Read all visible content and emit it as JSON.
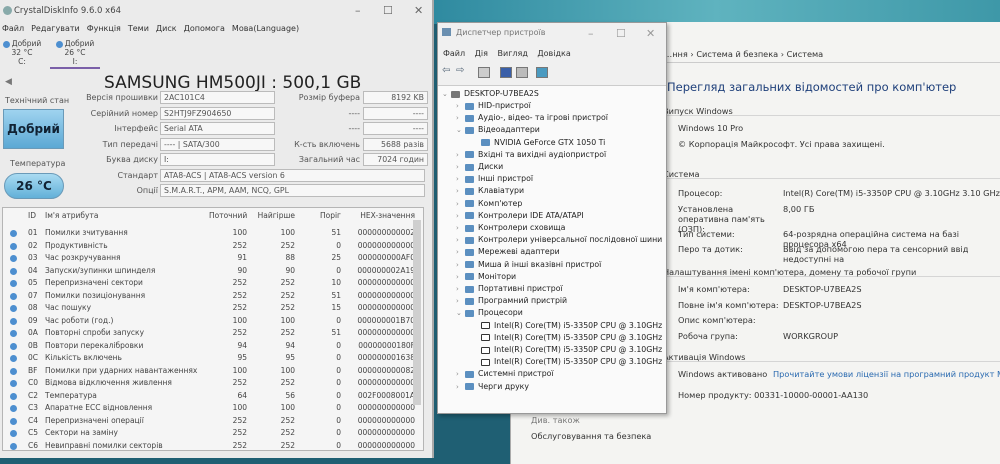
{
  "cdi": {
    "title": "CrystalDiskInfo 9.6.0 x64",
    "menu": [
      "Файл",
      "Редагувати",
      "Функція",
      "Теми",
      "Диск",
      "Допомога",
      "Мова(Language)"
    ],
    "drives": [
      {
        "status": "Добрий",
        "temp": "32 °C",
        "letter": "C:"
      },
      {
        "status": "Добрий",
        "temp": "26 °C",
        "letter": "I:"
      }
    ],
    "model": "SAMSUNG HM500JI : 500,1 GB",
    "health_label": "Технічний стан",
    "health": "Добрий",
    "temp_label": "Температура",
    "temp": "26 °C",
    "fields": [
      {
        "label": "Версія прошивки",
        "value": "2AC101C4"
      },
      {
        "label": "Серійний номер",
        "value": "S2HTJ9FZ904650"
      },
      {
        "label": "Інтерфейс",
        "value": "Serial ATA"
      },
      {
        "label": "Тип передачі",
        "value": "---- | SATA/300"
      },
      {
        "label": "Буква диску",
        "value": "I:"
      },
      {
        "label": "Стандарт",
        "value": "ATA8-ACS | ATA8-ACS version 6"
      },
      {
        "label": "Опції",
        "value": "S.M.A.R.T., APM, AAM, NCQ, GPL"
      }
    ],
    "right_fields": [
      {
        "label": "Розмір буфера",
        "value": "8192 KB"
      },
      {
        "label": "----",
        "value": "----"
      },
      {
        "label": "----",
        "value": "----"
      },
      {
        "label": "К-сть включень",
        "value": "5688 разів"
      },
      {
        "label": "Загальний час",
        "value": "7024 годин"
      }
    ],
    "columns": [
      "ID",
      "Ім'я атрибута",
      "Поточний",
      "Найгірше",
      "Поріг",
      "HEX-значення"
    ],
    "rows": [
      [
        "01",
        "Помилки зчитування",
        "100",
        "100",
        "51",
        "000000000002"
      ],
      [
        "02",
        "Продуктивність",
        "252",
        "252",
        "0",
        "000000000000"
      ],
      [
        "03",
        "Час розкручування",
        "91",
        "88",
        "25",
        "000000000AF0"
      ],
      [
        "04",
        "Запуски/зупинки шпинделя",
        "90",
        "90",
        "0",
        "000000002A19"
      ],
      [
        "05",
        "Перепризначені сектори",
        "252",
        "252",
        "10",
        "000000000000"
      ],
      [
        "07",
        "Помилки позиціонування",
        "252",
        "252",
        "51",
        "000000000000"
      ],
      [
        "08",
        "Час пошуку",
        "252",
        "252",
        "15",
        "000000000000"
      ],
      [
        "09",
        "Час роботи (год.)",
        "100",
        "100",
        "0",
        "000000001B70"
      ],
      [
        "0A",
        "Повторні спроби запуску",
        "252",
        "252",
        "51",
        "000000000000"
      ],
      [
        "0B",
        "Повтори перекалібровки",
        "94",
        "94",
        "0",
        "00000000180F"
      ],
      [
        "0C",
        "Кількість включень",
        "95",
        "95",
        "0",
        "000000001638"
      ],
      [
        "BF",
        "Помилки при ударних навантаженнях",
        "100",
        "100",
        "0",
        "000000000082"
      ],
      [
        "C0",
        "Відмова відключення живлення",
        "252",
        "252",
        "0",
        "000000000000"
      ],
      [
        "C2",
        "Температура",
        "64",
        "56",
        "0",
        "002F0008001A"
      ],
      [
        "C3",
        "Апаратне ECC відновлення",
        "100",
        "100",
        "0",
        "000000000000"
      ],
      [
        "C4",
        "Перепризначені операції",
        "252",
        "252",
        "0",
        "000000000000"
      ],
      [
        "C5",
        "Сектори на заміну",
        "252",
        "252",
        "0",
        "000000000000"
      ],
      [
        "C6",
        "Невиправні помилки секторів",
        "252",
        "252",
        "0",
        "000000000000"
      ]
    ]
  },
  "dm": {
    "title": "Диспетчер пристроїв",
    "menu": [
      "Файл",
      "Дія",
      "Вигляд",
      "Довідка"
    ],
    "root": "DESKTOP-U7BEA2S",
    "items": [
      {
        "label": "HID-пристрої",
        "level": 1,
        "expanded": false
      },
      {
        "label": "Аудіо-, відео- та ігрові пристрої",
        "level": 1,
        "expanded": false
      },
      {
        "label": "Відеоадаптери",
        "level": 1,
        "expanded": true
      },
      {
        "label": "NVIDIA GeForce GTX 1050 Ti",
        "level": 2
      },
      {
        "label": "Вхідні та вихідні аудіопристрої",
        "level": 1,
        "expanded": false
      },
      {
        "label": "Диски",
        "level": 1,
        "expanded": false
      },
      {
        "label": "Інші пристрої",
        "level": 1,
        "expanded": false
      },
      {
        "label": "Клавіатури",
        "level": 1,
        "expanded": false
      },
      {
        "label": "Комп'ютер",
        "level": 1,
        "expanded": false
      },
      {
        "label": "Контролери IDE ATA/ATAPI",
        "level": 1,
        "expanded": false
      },
      {
        "label": "Контролери сховища",
        "level": 1,
        "expanded": false
      },
      {
        "label": "Контролери універсальної послідовної шини",
        "level": 1,
        "expanded": false
      },
      {
        "label": "Мережеві адаптери",
        "level": 1,
        "expanded": false
      },
      {
        "label": "Миша й інші вказівні пристрої",
        "level": 1,
        "expanded": false
      },
      {
        "label": "Монітори",
        "level": 1,
        "expanded": false
      },
      {
        "label": "Портативні пристрої",
        "level": 1,
        "expanded": false
      },
      {
        "label": "Програмний пристрій",
        "level": 1,
        "expanded": false
      },
      {
        "label": "Процесори",
        "level": 1,
        "expanded": true
      },
      {
        "label": "Intel(R) Core(TM) i5-3350P CPU @ 3.10GHz",
        "level": 2
      },
      {
        "label": "Intel(R) Core(TM) i5-3350P CPU @ 3.10GHz",
        "level": 2
      },
      {
        "label": "Intel(R) Core(TM) i5-3350P CPU @ 3.10GHz",
        "level": 2
      },
      {
        "label": "Intel(R) Core(TM) i5-3350P CPU @ 3.10GHz",
        "level": 2
      },
      {
        "label": "Системні пристрої",
        "level": 1,
        "expanded": false
      },
      {
        "label": "Черги друку",
        "level": 1,
        "expanded": false
      }
    ]
  },
  "sys": {
    "breadcrumb": [
      "…ння",
      "Система й безпека",
      "Система"
    ],
    "heading": "Перегляд загальних відомостей про комп'ютер",
    "edition_section": "Випуск Windows",
    "edition": "Windows 10 Pro",
    "copyright": "© Корпорація Майкрософт. Усі права захищені.",
    "system_section": "Система",
    "system": [
      {
        "label": "Процесор:",
        "value": "Intel(R) Core(TM) i5-3350P CPU @ 3.10GHz   3.10 GHz"
      },
      {
        "label": "Установлена оперативна пам'ять (ОЗП):",
        "value": "8,00 ГБ"
      },
      {
        "label": "Тип системи:",
        "value": "64-розрядна операційна система на базі процесора x64"
      },
      {
        "label": "Перо та дотик:",
        "value": "Ввід за допомогою пера та сенсорний ввід недоступні на"
      }
    ],
    "name_section": "Налаштування імені комп'ютера, домену та робочої групи",
    "names": [
      {
        "label": "Ім'я комп'ютера:",
        "value": "DESKTOP-U7BEA2S"
      },
      {
        "label": "Повне ім'я комп'ютера:",
        "value": "DESKTOP-U7BEA2S"
      },
      {
        "label": "Опис комп'ютера:",
        "value": ""
      },
      {
        "label": "Робоча група:",
        "value": "WORKGROUP"
      }
    ],
    "activation_section": "Активація Windows",
    "activated": "Windows активовано",
    "license_link": "Прочитайте умови ліцензії на програмний продукт Microsoft",
    "product_id": "Номер продукту: 00331-10000-00001-AA130",
    "see_also": "Див. також",
    "maintenance": "Обслуговування та безпека"
  }
}
